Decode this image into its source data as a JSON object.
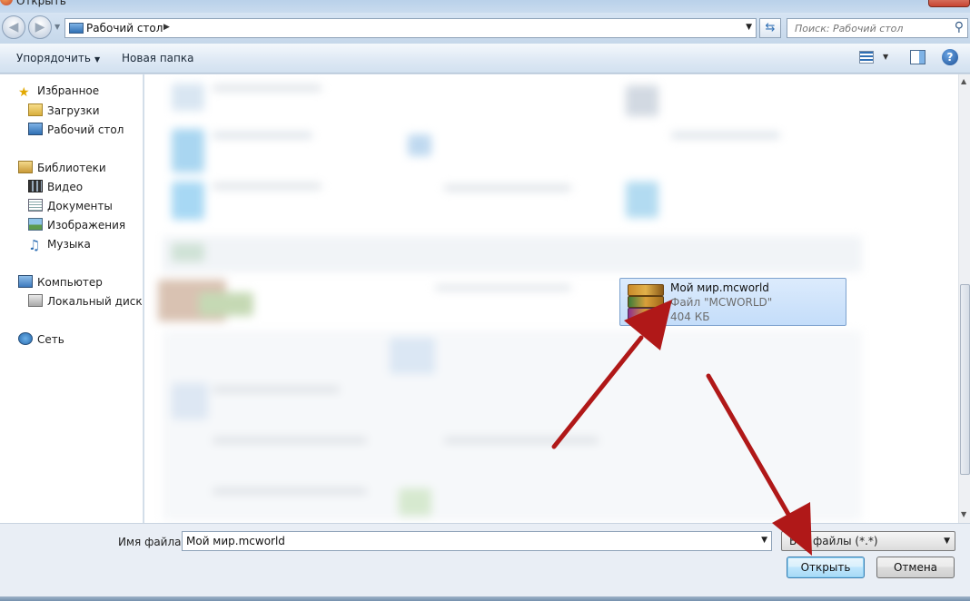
{
  "window": {
    "title": "Открыть"
  },
  "navigation": {
    "back_icon": "back-arrow-icon",
    "forward_icon": "forward-arrow-icon",
    "address_crumb": "Рабочий стол",
    "search_placeholder": "Поиск: Рабочий стол"
  },
  "toolbar": {
    "organize_label": "Упорядочить",
    "new_folder_label": "Новая папка",
    "views_icon": "views-icon",
    "preview_icon": "preview-pane-icon",
    "help_icon": "help-icon",
    "help_glyph": "?"
  },
  "sidebar": {
    "favorites": {
      "label": "Избранное",
      "items": [
        {
          "label": "Загрузки",
          "icon": "downloads-folder-icon"
        },
        {
          "label": "Рабочий стол",
          "icon": "desktop-icon"
        }
      ]
    },
    "libraries": {
      "label": "Библиотеки",
      "items": [
        {
          "label": "Видео",
          "icon": "video-library-icon"
        },
        {
          "label": "Документы",
          "icon": "documents-library-icon"
        },
        {
          "label": "Изображения",
          "icon": "pictures-library-icon"
        },
        {
          "label": "Музыка",
          "icon": "music-library-icon"
        }
      ]
    },
    "computer": {
      "label": "Компьютер",
      "items": [
        {
          "label": "Локальный диск (C",
          "icon": "local-disk-icon"
        }
      ]
    },
    "network": {
      "label": "Сеть"
    }
  },
  "selected_file": {
    "name": "Мой мир.mcworld",
    "type": "Файл \"MCWORLD\"",
    "size": "404 КБ",
    "icon": "winrar-archive-icon"
  },
  "footer": {
    "filename_label": "Имя файла:",
    "filename_value": "Мой мир.mcworld",
    "filetype_value": "Все файлы (*.*)",
    "open_label": "Открыть",
    "cancel_label": "Отмена"
  },
  "colors": {
    "annotation_arrow": "#b01818",
    "selection": "#c4ddfa",
    "primary_button": "#bee6fd"
  }
}
